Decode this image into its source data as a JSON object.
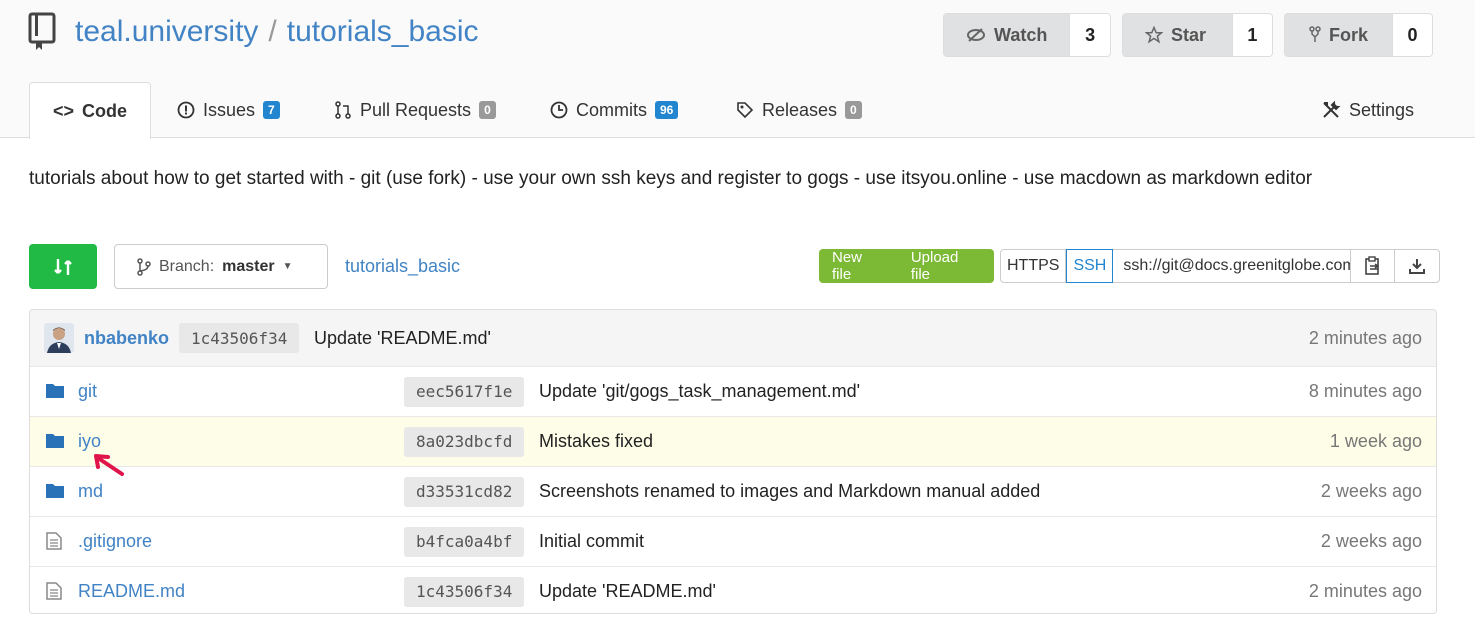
{
  "repo": {
    "owner": "teal.university",
    "separator": "/",
    "name": "tutorials_basic"
  },
  "actions": {
    "watch": {
      "label": "Watch",
      "count": "3"
    },
    "star": {
      "label": "Star",
      "count": "1"
    },
    "fork": {
      "label": "Fork",
      "count": "0"
    }
  },
  "tabs": {
    "code": {
      "label": "Code"
    },
    "issues": {
      "label": "Issues",
      "count": "7"
    },
    "pulls": {
      "label": "Pull Requests",
      "count": "0"
    },
    "commits": {
      "label": "Commits",
      "count": "96"
    },
    "releases": {
      "label": "Releases",
      "count": "0"
    },
    "settings": {
      "label": "Settings"
    }
  },
  "description": "tutorials about how to get started with - git (use fork) - use your own ssh keys and register to gogs - use itsyou.online - use macdown as markdown editor",
  "toolbar": {
    "branch_prefix": "Branch:",
    "branch": "master",
    "breadcrumb": "tutorials_basic",
    "new_file": "New file",
    "upload_file": "Upload file",
    "https": "HTTPS",
    "ssh": "SSH",
    "clone_url": "ssh://git@docs.greenitglobe.com"
  },
  "latest_commit": {
    "author": "nbabenko",
    "sha": "1c43506f34",
    "message": "Update 'README.md'",
    "time": "2 minutes ago"
  },
  "files": [
    {
      "type": "folder",
      "name": "git",
      "sha": "eec5617f1e",
      "message": "Update 'git/gogs_task_management.md'",
      "time": "8 minutes ago"
    },
    {
      "type": "folder",
      "name": "iyo",
      "sha": "8a023dbcfd",
      "message": "Mistakes fixed",
      "time": "1 week ago"
    },
    {
      "type": "folder",
      "name": "md",
      "sha": "d33531cd82",
      "message": "Screenshots renamed to images and Markdown manual added",
      "time": "2 weeks ago"
    },
    {
      "type": "file",
      "name": ".gitignore",
      "sha": "b4fca0a4bf",
      "message": "Initial commit",
      "time": "2 weeks ago"
    },
    {
      "type": "file",
      "name": "README.md",
      "sha": "1c43506f34",
      "message": "Update 'README.md'",
      "time": "2 minutes ago"
    }
  ],
  "colors": {
    "accent_blue": "#4183c4",
    "green": "#21ba45",
    "file_btn_green": "#7cb935",
    "highlight_row": "#fefee8",
    "annotation_arrow": "#e0134a"
  }
}
